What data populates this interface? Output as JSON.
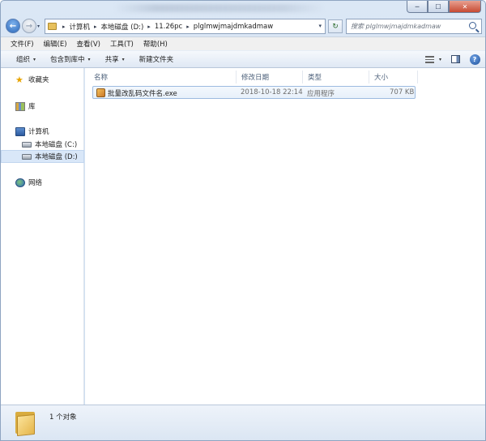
{
  "window": {
    "minimize_glyph": "─",
    "maximize_glyph": "☐",
    "close_glyph": "✕"
  },
  "nav": {
    "back_glyph": "←",
    "forward_glyph": "→",
    "dropdown_glyph": "▾"
  },
  "address": {
    "crumbs": [
      "计算机",
      "本地磁盘 (D:)",
      "11.26pc",
      "plglmwjmajdmkadmaw"
    ],
    "separator": "▸",
    "dropdown_glyph": "▾",
    "refresh_glyph": "↻"
  },
  "search": {
    "placeholder": "搜索 plglmwjmajdmkadmaw",
    "icon": "search-icon"
  },
  "menu": {
    "items": [
      "文件(F)",
      "编辑(E)",
      "查看(V)",
      "工具(T)",
      "帮助(H)"
    ]
  },
  "toolbar": {
    "organize": "组织",
    "include_in_library": "包含到库中",
    "share": "共享",
    "new_folder": "新建文件夹",
    "arrow": "▾",
    "help_glyph": "?"
  },
  "sidebar": {
    "favorites": "收藏夹",
    "libraries": "库",
    "computer": "计算机",
    "drive_c": "本地磁盘 (C:)",
    "drive_d": "本地磁盘 (D:)",
    "network": "网络"
  },
  "columns": {
    "name": "名称",
    "date": "修改日期",
    "type": "类型",
    "size": "大小"
  },
  "files": [
    {
      "name": "批量改乱码文件名.exe",
      "date": "2018-10-18 22:14",
      "type": "应用程序",
      "size": "707 KB"
    }
  ],
  "status": {
    "item_count": "1 个对象"
  }
}
